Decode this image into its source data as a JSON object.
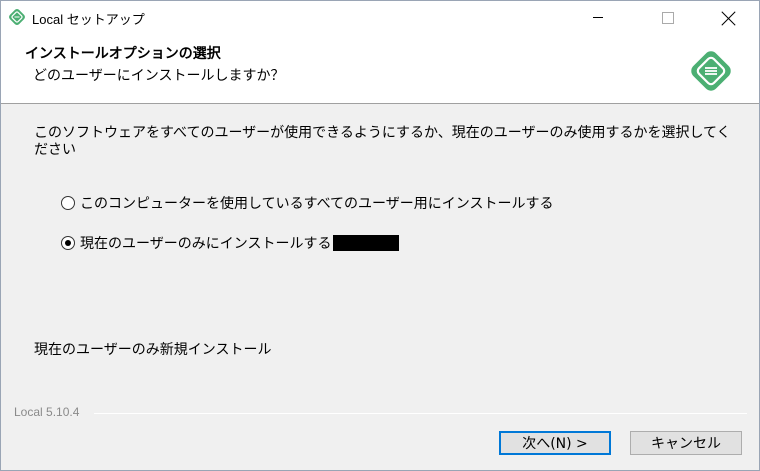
{
  "window": {
    "title": "Local セットアップ",
    "icon": "local-logo-icon"
  },
  "header": {
    "title": "インストールオプションの選択",
    "subtitle": "どのユーザーにインストールしますか？",
    "logo": "local-logo-icon"
  },
  "body": {
    "description": "このソフトウェアをすべてのユーザーが使用できるようにするか、現在のユーザーのみ使用するかを選択してください",
    "options": [
      {
        "label": "このコンピューターを使用しているすべてのユーザー用にインストールする",
        "selected": false
      },
      {
        "label": "現在のユーザーのみにインストールする",
        "selected": true
      }
    ],
    "status": "現在のユーザーのみ新規インストール"
  },
  "footer": {
    "version": "Local 5.10.4",
    "next_label": "次へ(N) >",
    "cancel_label": "キャンセル"
  },
  "colors": {
    "accent": "#0078d7",
    "logo_green": "#4caf73"
  }
}
